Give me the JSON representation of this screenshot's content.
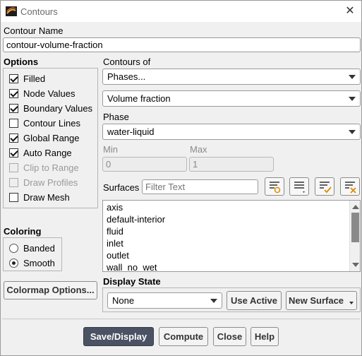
{
  "window": {
    "title": "Contours",
    "close_icon": "close-icon",
    "app_icon": "fluent-app-icon"
  },
  "contour_name": {
    "label": "Contour Name",
    "value": "contour-volume-fraction"
  },
  "options": {
    "label": "Options",
    "items": [
      {
        "label": "Filled",
        "checked": true,
        "enabled": true
      },
      {
        "label": "Node Values",
        "checked": true,
        "enabled": true
      },
      {
        "label": "Boundary Values",
        "checked": true,
        "enabled": true
      },
      {
        "label": "Contour Lines",
        "checked": false,
        "enabled": true
      },
      {
        "label": "Global Range",
        "checked": true,
        "enabled": true
      },
      {
        "label": "Auto Range",
        "checked": true,
        "enabled": true
      },
      {
        "label": "Clip to Range",
        "checked": false,
        "enabled": false
      },
      {
        "label": "Draw Profiles",
        "checked": false,
        "enabled": false
      },
      {
        "label": "Draw Mesh",
        "checked": false,
        "enabled": true
      }
    ]
  },
  "coloring": {
    "label": "Coloring",
    "items": [
      {
        "label": "Banded",
        "selected": false
      },
      {
        "label": "Smooth",
        "selected": true
      }
    ]
  },
  "colormap_button": "Colormap Options...",
  "contours_of": {
    "label": "Contours of",
    "category": "Phases...",
    "variable": "Volume fraction"
  },
  "phase": {
    "label": "Phase",
    "value": "water-liquid"
  },
  "range": {
    "min_label": "Min",
    "min_value": "0",
    "max_label": "Max",
    "max_value": "1"
  },
  "surfaces": {
    "label": "Surfaces",
    "filter_placeholder": "Filter Text",
    "items": [
      "axis",
      "default-interior",
      "fluid",
      "inlet",
      "outlet",
      "wall_no_wet"
    ]
  },
  "display_state": {
    "label": "Display State",
    "value": "None",
    "use_active": "Use Active",
    "new_surface": "New Surface"
  },
  "footer": {
    "save_display": "Save/Display",
    "compute": "Compute",
    "close": "Close",
    "help": "Help"
  },
  "colors": {
    "primary_button": "#4a5263",
    "scroll_thumb": "#8a8a8a"
  }
}
